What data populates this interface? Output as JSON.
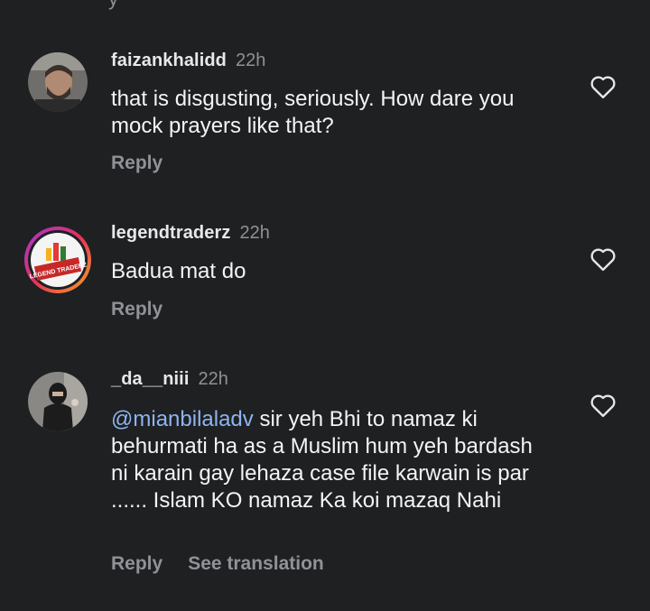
{
  "top_fragment": "y",
  "comments": [
    {
      "username": "faizankhalidd",
      "time": "22h",
      "text": "that is disgusting, seriously. How dare you mock prayers like that?",
      "mention": "",
      "reply_label": "Reply",
      "translate_label": "",
      "avatar": "person-photo"
    },
    {
      "username": "legendtraderz",
      "time": "22h",
      "text": "Badua mat do",
      "mention": "",
      "reply_label": "Reply",
      "translate_label": "",
      "avatar": "legend-traderz-logo",
      "logo_text": "LEGEND TRADERZ"
    },
    {
      "username": "_da__niii",
      "time": "22h",
      "mention": "@mianbilaladv",
      "text": " sir yeh Bhi to namaz ki behurmati ha as a Muslim hum yeh bardash ni karain gay lehaza case file karwain is par ...... Islam KO namaz Ka koi mazaq Nahi",
      "reply_label": "Reply",
      "translate_label": "See translation",
      "avatar": "person-photo"
    }
  ],
  "colors": {
    "background": "#1e2022",
    "mention": "#8fb4ee",
    "secondary": "#8f9296"
  }
}
